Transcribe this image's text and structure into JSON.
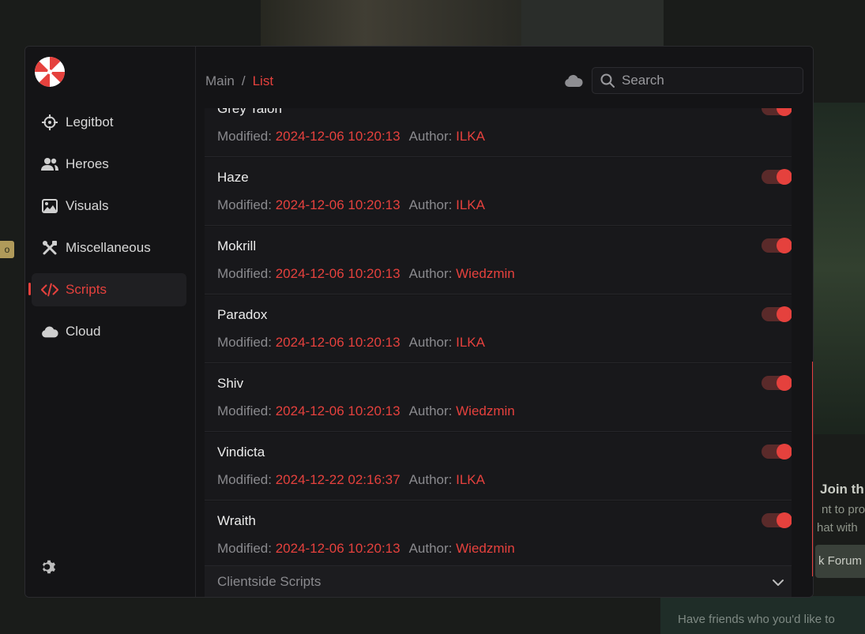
{
  "background": {
    "tag": "o",
    "promo_title": "Join th",
    "promo_line1": "nt to pro",
    "promo_line2": "hat with",
    "promo_button": "k Forum",
    "invite_text": "Have friends who you'd like to"
  },
  "sidebar": {
    "logo": "umbrella-logo",
    "items": [
      {
        "label": "Legitbot",
        "icon": "crosshair-icon"
      },
      {
        "label": "Heroes",
        "icon": "users-icon"
      },
      {
        "label": "Visuals",
        "icon": "image-icon"
      },
      {
        "label": "Miscellaneous",
        "icon": "tools-icon"
      },
      {
        "label": "Scripts",
        "icon": "code-icon"
      },
      {
        "label": "Cloud",
        "icon": "cloud-icon"
      }
    ],
    "active": "Scripts",
    "settings_icon": "gear-icon"
  },
  "header": {
    "breadcrumb_root": "Main",
    "breadcrumb_sep": "/",
    "breadcrumb_current": "List",
    "search_placeholder": "Search"
  },
  "meta_labels": {
    "modified": "Modified:",
    "author": "Author:"
  },
  "scripts": [
    {
      "name": "Grey Talon",
      "modified": "2024-12-06 10:20:13",
      "author": "ILKA",
      "enabled": true
    },
    {
      "name": "Haze",
      "modified": "2024-12-06 10:20:13",
      "author": "ILKA",
      "enabled": true
    },
    {
      "name": "Mokrill",
      "modified": "2024-12-06 10:20:13",
      "author": "Wiedzmin",
      "enabled": true
    },
    {
      "name": "Paradox",
      "modified": "2024-12-06 10:20:13",
      "author": "ILKA",
      "enabled": true
    },
    {
      "name": "Shiv",
      "modified": "2024-12-06 10:20:13",
      "author": "Wiedzmin",
      "enabled": true
    },
    {
      "name": "Vindicta",
      "modified": "2024-12-22 02:16:37",
      "author": "ILKA",
      "enabled": true
    },
    {
      "name": "Wraith",
      "modified": "2024-12-06 10:20:13",
      "author": "Wiedzmin",
      "enabled": true
    }
  ],
  "section": {
    "label": "Clientside Scripts",
    "icon": "chevron-down-icon"
  },
  "colors": {
    "accent": "#e5413d",
    "panel": "#141416",
    "row": "#18181b"
  }
}
